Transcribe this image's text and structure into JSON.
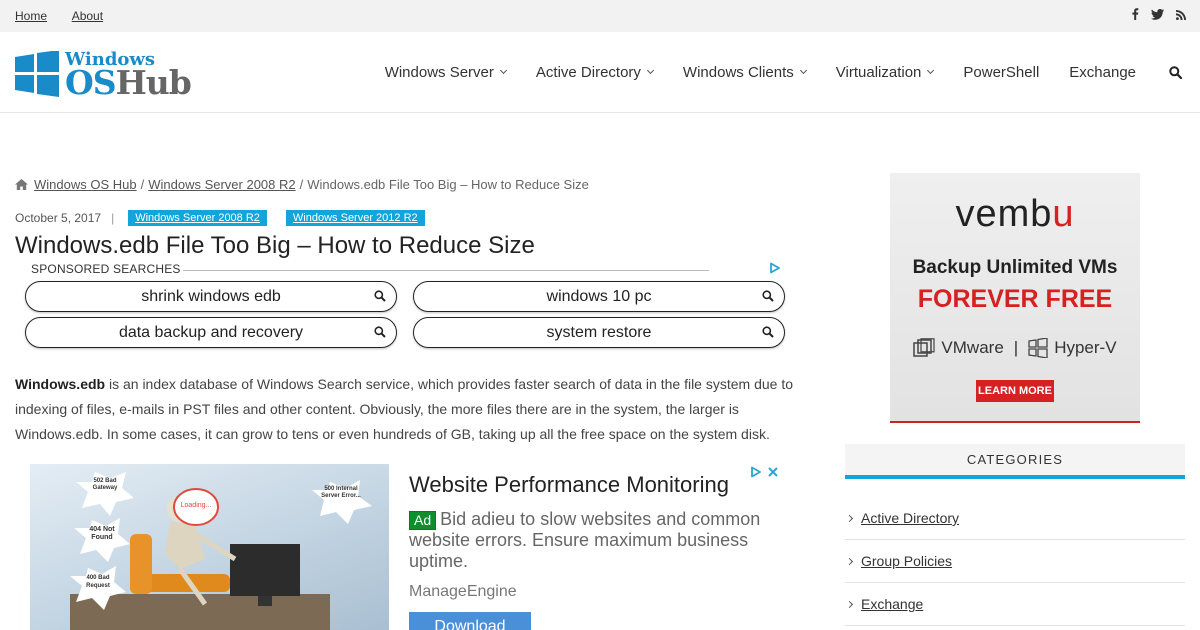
{
  "topbar": {
    "links": [
      "Home",
      "About"
    ],
    "social": [
      {
        "icon": "facebook-icon",
        "glyph": "f"
      },
      {
        "icon": "twitter-icon",
        "glyph": "t"
      },
      {
        "icon": "rss-icon",
        "glyph": "rss"
      }
    ]
  },
  "logo": {
    "line1": "Windows",
    "os": "OS",
    "hub": "Hub"
  },
  "nav": {
    "items": [
      {
        "label": "Windows Server",
        "dropdown": true
      },
      {
        "label": "Active Directory",
        "dropdown": true
      },
      {
        "label": "Windows Clients",
        "dropdown": true
      },
      {
        "label": "Virtualization",
        "dropdown": true
      },
      {
        "label": "PowerShell",
        "dropdown": false
      },
      {
        "label": "Exchange",
        "dropdown": false
      }
    ],
    "search_icon": "search-icon"
  },
  "breadcrumb": {
    "home": "Windows OS Hub",
    "section": "Windows Server 2008 R2",
    "current": "Windows.edb File Too Big – How to Reduce Size",
    "sep": "/"
  },
  "meta": {
    "date": "October 5, 2017",
    "divider": "|",
    "tags": [
      "Windows Server 2008 R2",
      "Windows Server 2012 R2"
    ]
  },
  "article": {
    "title": "Windows.edb File Too Big – How to Reduce Size",
    "intro_bold": "Windows.edb",
    "intro_rest": " is an index database of Windows Search service, which provides faster search of data in the file system due to indexing of files, e-mails in PST files and other content. Obviously, the more files there are in the system, the larger is Windows.edb. In some cases, it can grow to tens or even hundreds of GB, taking up all the free space on the system disk."
  },
  "sponsored": {
    "label": "SPONSORED SEARCHES",
    "searches": [
      "shrink windows edb",
      "windows 10 pc",
      "data backup and recovery",
      "system restore"
    ]
  },
  "ad": {
    "headline": "Website Performance Monitoring",
    "badge": "Ad",
    "body": "Bid adieu to slow websites and common website errors. Ensure maximum business uptime.",
    "brand": "ManageEngine",
    "button": "Download",
    "image_labels": [
      "502 Bad Gateway",
      "Loading...",
      "500 Internal Server Error...",
      "404 Not Found",
      "400 Bad Request"
    ]
  },
  "banner": {
    "brand_a": "vemb",
    "brand_b": "u",
    "line1": "Backup Unlimited VMs",
    "line2": "FOREVER FREE",
    "vmware": "VMware",
    "bar": "|",
    "hyperv": "Hyper-V",
    "cta": "LEARN MORE"
  },
  "categories": {
    "heading": "CATEGORIES",
    "items": [
      "Active Directory",
      "Group Policies",
      "Exchange"
    ]
  },
  "colors": {
    "accent": "#12a5dc",
    "brand_red": "#d52121",
    "ad_green": "#0e8f2b",
    "button_blue": "#4a90d9"
  }
}
